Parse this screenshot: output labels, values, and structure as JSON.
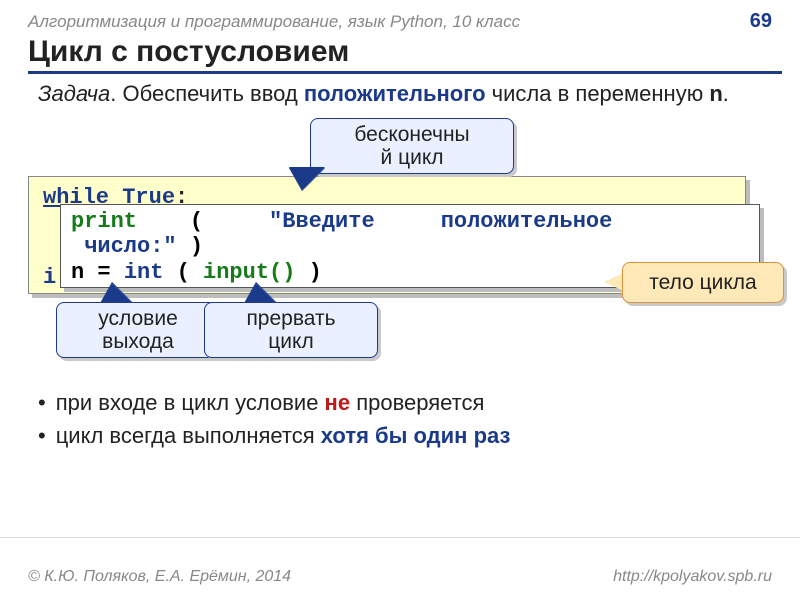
{
  "header": {
    "course": "Алгоритмизация и программирование, язык Python, 10 класс",
    "page": "69"
  },
  "title": "Цикл с постусловием",
  "task": {
    "label": "Задача",
    "before": ". Обеспечить ввод ",
    "highlight": "положительного",
    "mid": " числа в переменную ",
    "var": "n",
    "after": "."
  },
  "callouts": {
    "infloop_l1": "бесконечны",
    "infloop_l2": "й цикл",
    "exit_l1": "условие",
    "exit_l2": "выхода",
    "break_l1": "прервать",
    "break_l2": "цикл",
    "body": "тело цикла"
  },
  "code": {
    "while_kw": "while",
    "true_kw": "True",
    "colon": ":",
    "if_kw": "i",
    "print_kw": "print",
    "open_p": "(",
    "str1": "\"Введите",
    "str2": "положительное",
    "str3": "число:\"",
    "close_p": ")",
    "n_eq": "n =",
    "int_kw": "int",
    "input_kw": "input()"
  },
  "bullets": {
    "b1_a": "при входе в цикл условие ",
    "b1_hl": "не",
    "b1_b": " проверяется",
    "b2_a": "цикл всегда выполняется ",
    "b2_hl": "хотя бы один раз"
  },
  "footer": {
    "left": "© К.Ю. Поляков, Е.А. Ерёмин, 2014",
    "right": "http://kpolyakov.spb.ru"
  }
}
